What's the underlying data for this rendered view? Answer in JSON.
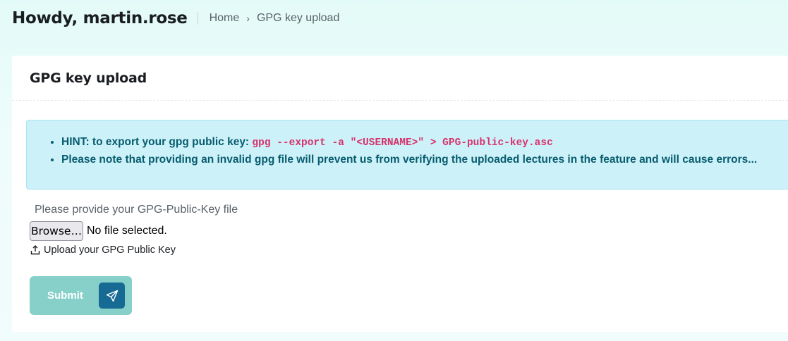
{
  "header": {
    "greeting": "Howdy, martin.rose",
    "breadcrumb": {
      "home": "Home",
      "separator": "›",
      "current": "GPG key upload"
    }
  },
  "card": {
    "title": "GPG key upload",
    "hint": {
      "line1_prefix": "HINT: to export your gpg public key:",
      "line1_code": "gpg --export -a \"<USERNAME>\" > GPG-public-key.asc",
      "line2": "Please note that providing an invalid gpg file will prevent us from verifying the uploaded lectures in the feature and will cause errors..."
    },
    "upload": {
      "label": "Please provide your GPG-Public-Key file",
      "browse_label": "Browse…",
      "file_status": "No file selected.",
      "helper_text": "Upload your GPG Public Key",
      "helper_icon": "upload-icon"
    },
    "submit": {
      "label": "Submit",
      "icon": "send-icon"
    }
  },
  "colors": {
    "hint_bg": "#cdf1f9",
    "hint_text": "#075c6e",
    "code": "#d6336c",
    "submit_bg": "#86d0c9",
    "submit_icon_bg": "#176a93"
  }
}
